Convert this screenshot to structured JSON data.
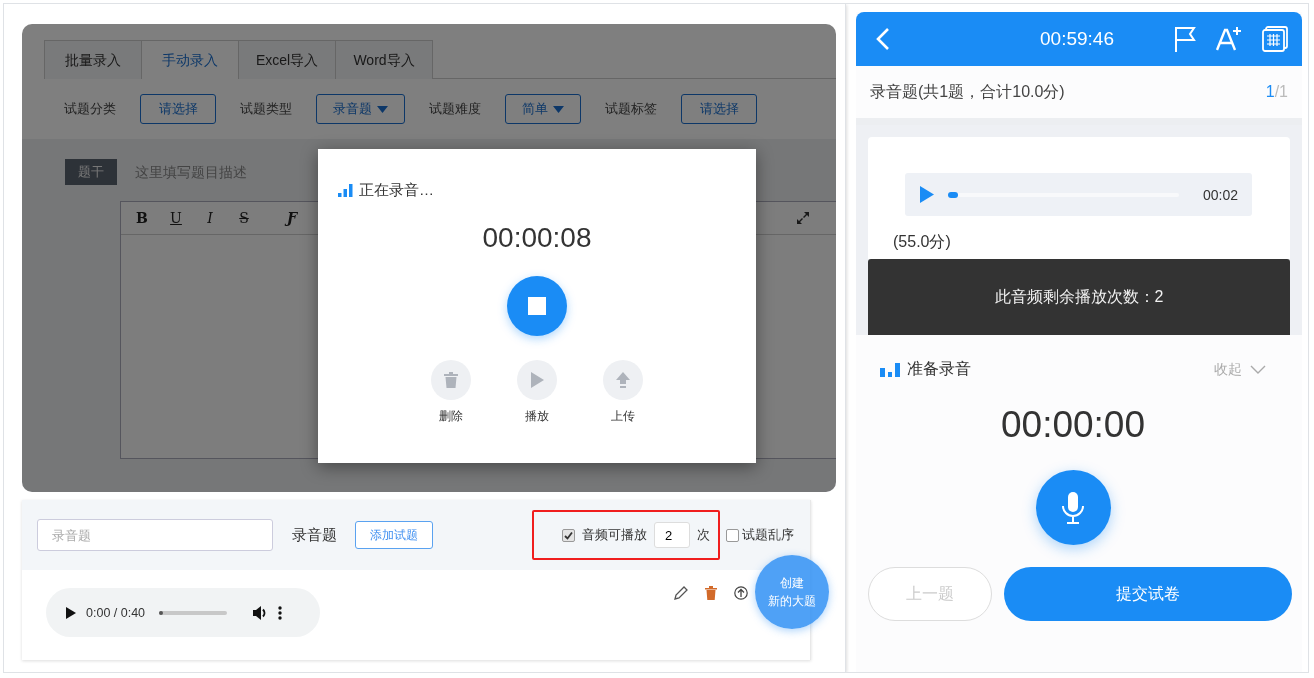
{
  "editor": {
    "tabs": [
      {
        "label": "批量录入",
        "selected": false
      },
      {
        "label": "手动录入",
        "selected": true
      },
      {
        "label": "Excel导入",
        "selected": false
      },
      {
        "label": "Word导入",
        "selected": false
      }
    ],
    "filters": [
      {
        "label": "试题分类",
        "value": "请选择",
        "dropdown": false
      },
      {
        "label": "试题类型",
        "value": "录音题",
        "dropdown": true
      },
      {
        "label": "试题难度",
        "value": "简单",
        "dropdown": true
      },
      {
        "label": "试题标签",
        "value": "请选择",
        "dropdown": false
      }
    ],
    "stem_label": "题干",
    "stem_placeholder": "这里填写题目描述",
    "toolbar": [
      {
        "kind": "bold",
        "label": "B"
      },
      {
        "kind": "underline",
        "label": "U"
      },
      {
        "kind": "italic",
        "label": "I"
      },
      {
        "kind": "strike",
        "label": "S"
      },
      {
        "kind": "font",
        "label": "Ƒ"
      }
    ]
  },
  "recording_dialog": {
    "status": "正在录音…",
    "timer": "00:00:08",
    "actions": [
      {
        "kind": "delete",
        "label": "删除"
      },
      {
        "kind": "play",
        "label": "播放"
      },
      {
        "kind": "upload",
        "label": "上传"
      }
    ]
  },
  "section": {
    "name_placeholder": "录音题",
    "type": "录音题",
    "add_button": "添加试题",
    "replay": {
      "checked": true,
      "label": "音频可播放",
      "count": "2",
      "unit": "次"
    },
    "shuffle": {
      "checked": false,
      "label": "试题乱序"
    },
    "player": {
      "time": "0:00 / 0:40",
      "level": 0.05
    },
    "fab": [
      "创建",
      "新的大题"
    ]
  },
  "mobile": {
    "timer": "00:59:46",
    "section_title": "录音题(共1题，合计10.0分)",
    "page_current": "1",
    "page_total": "/1",
    "player": {
      "time": "00:02",
      "level": 0.04
    },
    "score": "(55.0分)",
    "toast": "此音频剩余播放次数：2",
    "recorder": {
      "status": "准备录音",
      "collapse": "收起",
      "timer": "00:00:00"
    },
    "buttons": [
      {
        "label": "上一题",
        "disabled": true
      },
      {
        "label": "提交试卷",
        "disabled": false
      }
    ]
  }
}
